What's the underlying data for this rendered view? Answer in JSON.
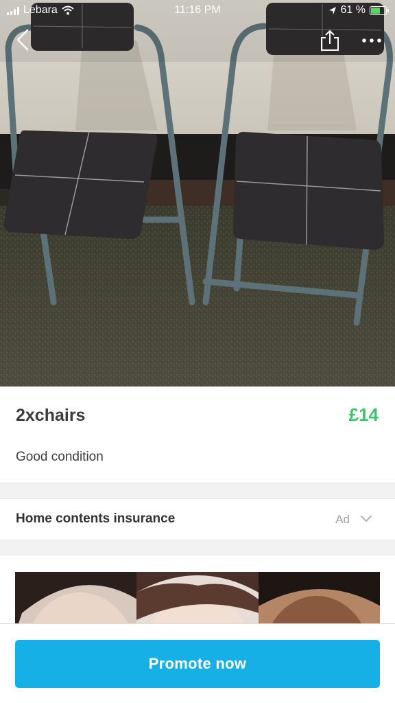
{
  "status_bar": {
    "carrier": "Lebara",
    "time": "11:16 PM",
    "battery_percent": "61 %",
    "battery_level": 0.61,
    "icons": [
      "signal-icon",
      "wifi-icon",
      "location-arrow-icon",
      "battery-charging-icon"
    ]
  },
  "nav": {
    "icons": [
      "back-chevron-icon",
      "share-icon",
      "more-dots-icon"
    ]
  },
  "photo": {
    "description_icon": "listing-photo"
  },
  "listing": {
    "title": "2xchairs",
    "price": "£14",
    "description": "Good condition"
  },
  "ad_row": {
    "title": "Home contents insurance",
    "badge": "Ad",
    "icon": "chevron-down-icon"
  },
  "bottom_bar": {
    "promote_label": "Promote now"
  },
  "colors": {
    "price": "#3cc36a",
    "promote_button": "#16b0e6",
    "battery_fill": "#4cd964"
  }
}
